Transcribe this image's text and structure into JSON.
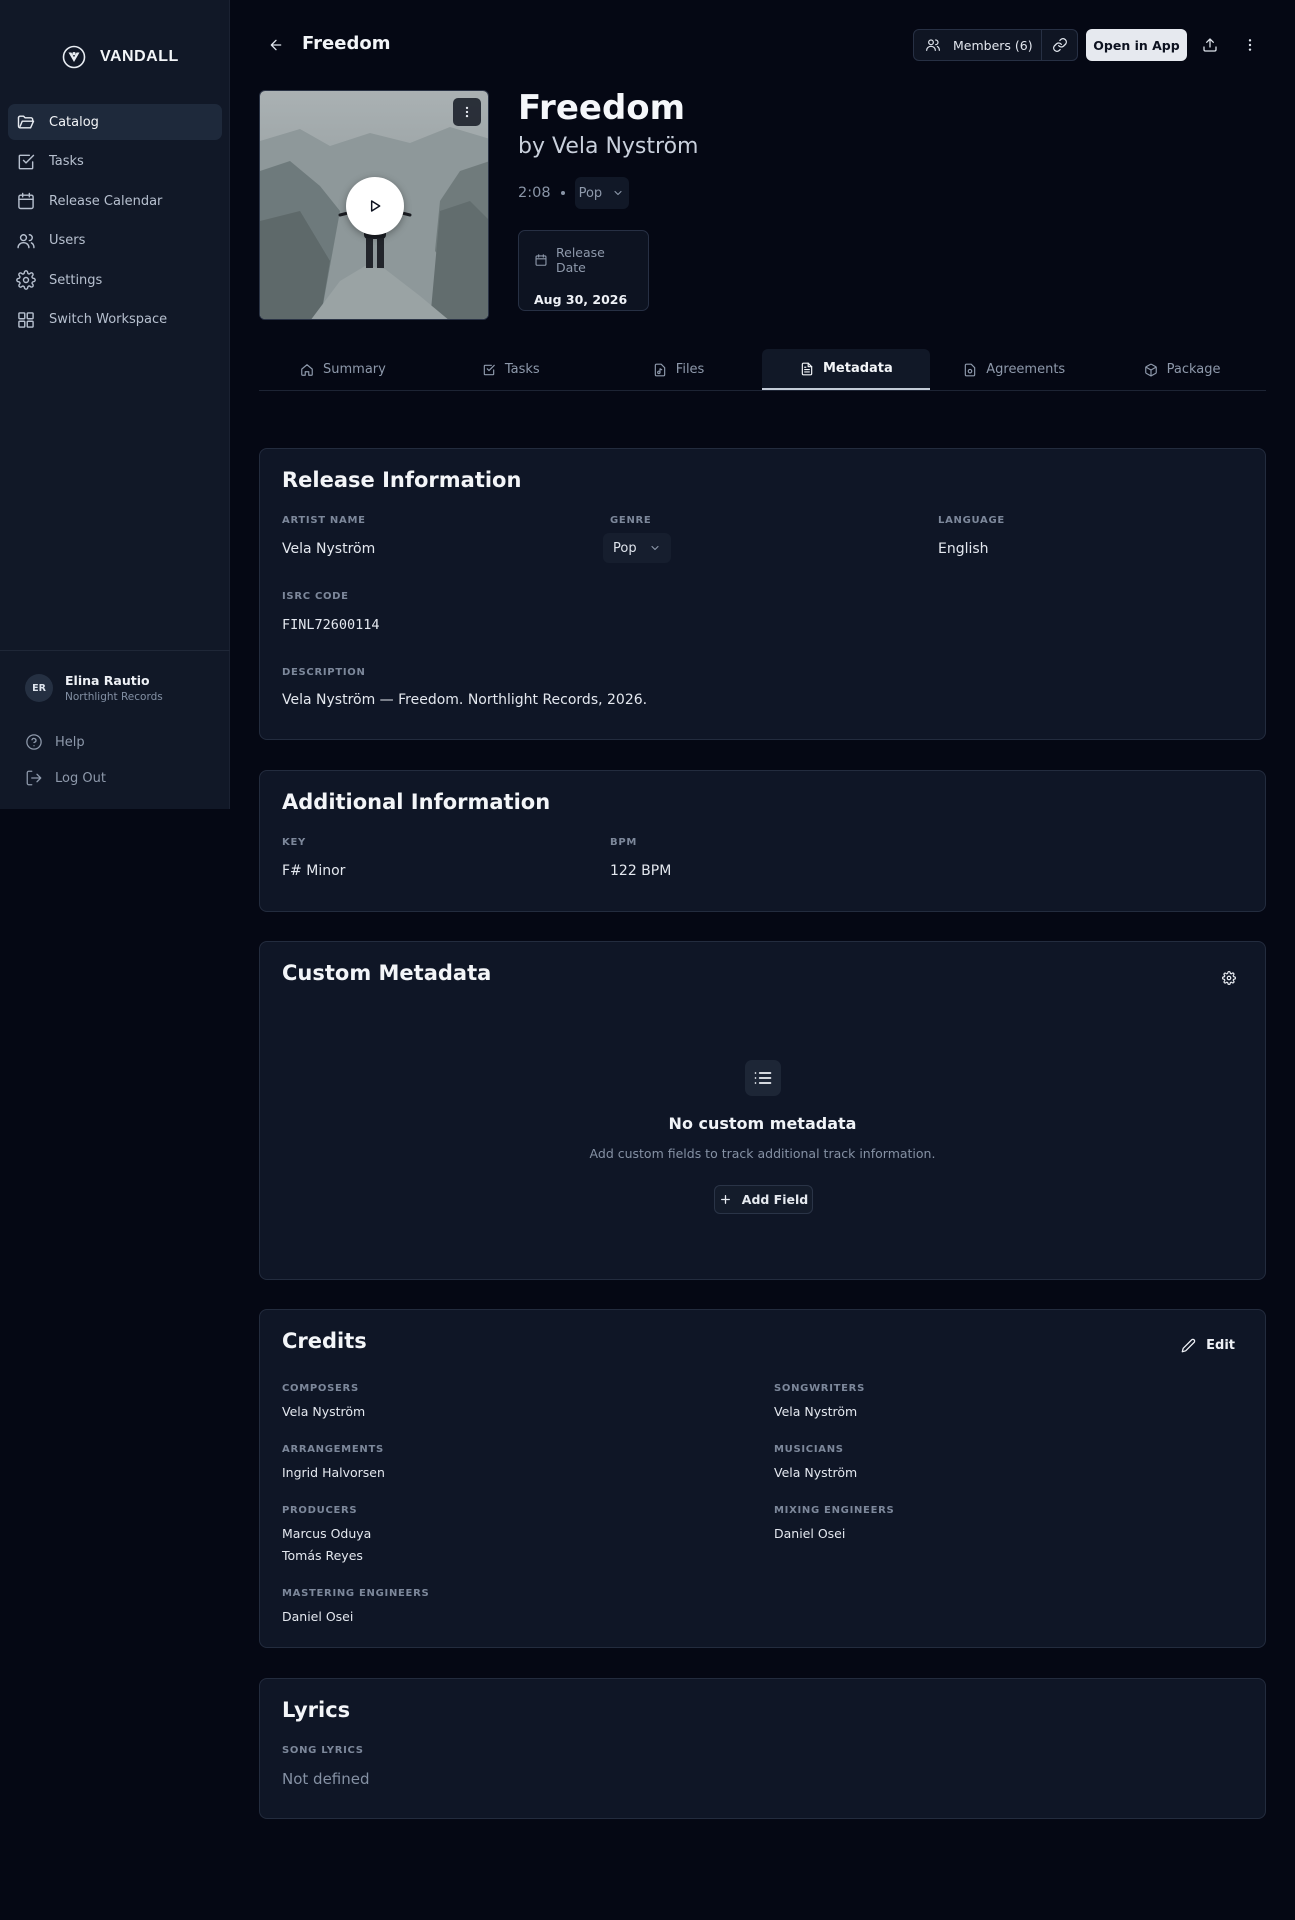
{
  "sidebar": {
    "brand": "VANDALL",
    "items": [
      {
        "label": "Catalog",
        "icon": "folder-open-icon",
        "active": true
      },
      {
        "label": "Tasks",
        "icon": "checkbox-icon",
        "active": false
      },
      {
        "label": "Release Calendar",
        "icon": "calendar-icon",
        "active": false
      },
      {
        "label": "Users",
        "icon": "users-icon",
        "active": false
      },
      {
        "label": "Settings",
        "icon": "gear-icon",
        "active": false
      },
      {
        "label": "Switch Workspace",
        "icon": "grid-icon",
        "active": false
      }
    ],
    "user": {
      "initials": "ER",
      "name": "Elina Rautio",
      "org": "Northlight Records"
    },
    "help": "Help",
    "logout": "Log Out"
  },
  "header": {
    "title": "Freedom",
    "members": "Members (6)",
    "open_in_app": "Open in App"
  },
  "track": {
    "title": "Freedom",
    "artist": "by Vela Nyström",
    "duration": "2:08",
    "genre": "Pop",
    "release_label": "Release Date",
    "release_date": "Aug 30, 2026"
  },
  "tabs": [
    {
      "label": "Summary",
      "icon": "home-icon",
      "active": false
    },
    {
      "label": "Tasks",
      "icon": "checkbox-icon",
      "active": false
    },
    {
      "label": "Files",
      "icon": "file-music-icon",
      "active": false
    },
    {
      "label": "Metadata",
      "icon": "file-text-icon",
      "active": true
    },
    {
      "label": "Agreements",
      "icon": "file-agreement-icon",
      "active": false
    },
    {
      "label": "Package",
      "icon": "package-icon",
      "active": false
    }
  ],
  "release_info": {
    "title": "Release Information",
    "artist_label": "ARTIST NAME",
    "artist": "Vela Nyström",
    "genre_label": "GENRE",
    "genre": "Pop",
    "language_label": "LANGUAGE",
    "language": "English",
    "isrc_label": "ISRC CODE",
    "isrc": "FINL72600114",
    "description_label": "DESCRIPTION",
    "description": "Vela Nyström — Freedom. Northlight Records, 2026."
  },
  "additional_info": {
    "title": "Additional Information",
    "key_label": "KEY",
    "key": "F# Minor",
    "bpm_label": "BPM",
    "bpm": "122 BPM"
  },
  "custom_metadata": {
    "title": "Custom Metadata",
    "empty_title": "No custom metadata",
    "empty_sub": "Add custom fields to track additional track information.",
    "add_field": "Add Field"
  },
  "credits": {
    "title": "Credits",
    "edit": "Edit",
    "composers_label": "COMPOSERS",
    "composers": [
      "Vela Nyström"
    ],
    "songwriters_label": "SONGWRITERS",
    "songwriters": [
      "Vela Nyström"
    ],
    "arrangements_label": "ARRANGEMENTS",
    "arrangements": [
      "Ingrid Halvorsen"
    ],
    "musicians_label": "MUSICIANS",
    "musicians": [
      "Vela Nyström"
    ],
    "producers_label": "PRODUCERS",
    "producers": [
      "Marcus Oduya",
      "Tomás Reyes"
    ],
    "mixing_label": "MIXING ENGINEERS",
    "mixing": [
      "Daniel Osei"
    ],
    "mastering_label": "MASTERING ENGINEERS",
    "mastering": [
      "Daniel Osei"
    ]
  },
  "lyrics": {
    "title": "Lyrics",
    "label": "SONG LYRICS",
    "value": "Not defined"
  }
}
